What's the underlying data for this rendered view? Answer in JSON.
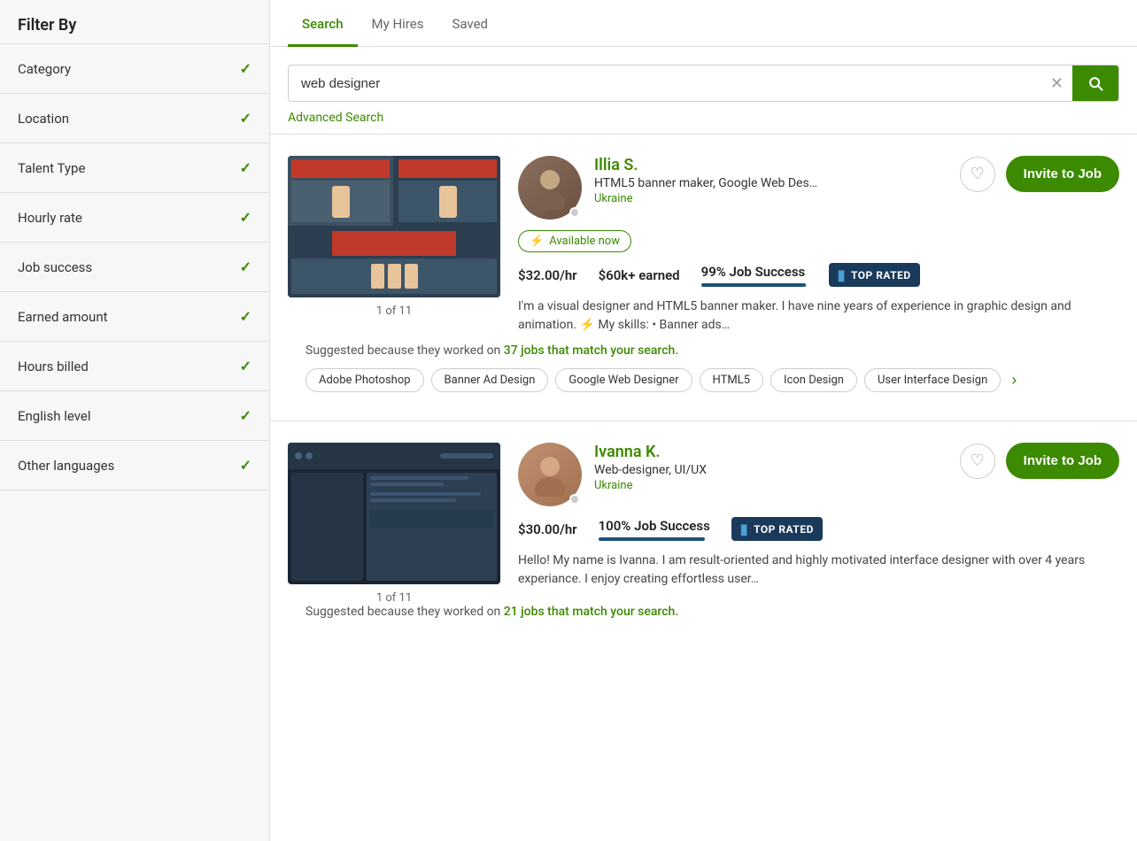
{
  "sidebar": {
    "title": "Filter By",
    "filters": [
      {
        "id": "category",
        "label": "Category"
      },
      {
        "id": "location",
        "label": "Location"
      },
      {
        "id": "talent-type",
        "label": "Talent Type"
      },
      {
        "id": "hourly-rate",
        "label": "Hourly rate"
      },
      {
        "id": "job-success",
        "label": "Job success"
      },
      {
        "id": "earned-amount",
        "label": "Earned amount"
      },
      {
        "id": "hours-billed",
        "label": "Hours billed"
      },
      {
        "id": "english-level",
        "label": "English level"
      },
      {
        "id": "other-languages",
        "label": "Other languages"
      }
    ]
  },
  "tabs": [
    {
      "id": "search",
      "label": "Search",
      "active": true
    },
    {
      "id": "my-hires",
      "label": "My Hires",
      "active": false
    },
    {
      "id": "saved",
      "label": "Saved",
      "active": false
    }
  ],
  "search": {
    "query": "web designer",
    "placeholder": "Search",
    "advanced_label": "Advanced Search",
    "clear_icon": "✕"
  },
  "freelancers": [
    {
      "id": "illia",
      "name": "Illia S.",
      "title": "HTML5 banner maker, Google Web Des…",
      "location": "Ukraine",
      "available": true,
      "available_label": "Available now",
      "rate": "$32.00/hr",
      "earned": "$60k+ earned",
      "job_success": "99% Job Success",
      "job_success_pct": 99,
      "top_rated": true,
      "top_rated_label": "TOP RATED",
      "description": "I'm a visual designer and HTML5 banner maker. I have nine years of experience in graphic design and animation. ⚡ My skills: • Banner ads…",
      "suggested_text": "Suggested because they worked on ",
      "suggested_link": "37 jobs that match your search.",
      "portfolio_count": "1 of 11",
      "invite_label": "Invite to Job",
      "skills": [
        "Adobe Photoshop",
        "Banner Ad Design",
        "Google Web Designer",
        "HTML5",
        "Icon Design",
        "User Interface Design"
      ],
      "more_skills": true
    },
    {
      "id": "ivanna",
      "name": "Ivanna K.",
      "title": "Web-designer, UI/UX",
      "location": "Ukraine",
      "available": false,
      "available_label": "",
      "rate": "$30.00/hr",
      "earned": "",
      "job_success": "100% Job Success",
      "job_success_pct": 100,
      "top_rated": true,
      "top_rated_label": "TOP RATED",
      "description": "Hello! My name is Ivanna. I am result-oriented and highly motivated interface designer with over 4 years experiance. I enjoy creating effortless user…",
      "suggested_text": "Suggested because they worked on ",
      "suggested_link": "21 jobs that match your search.",
      "portfolio_count": "1 of 11",
      "invite_label": "Invite to Job",
      "skills": [],
      "more_skills": false
    }
  ]
}
